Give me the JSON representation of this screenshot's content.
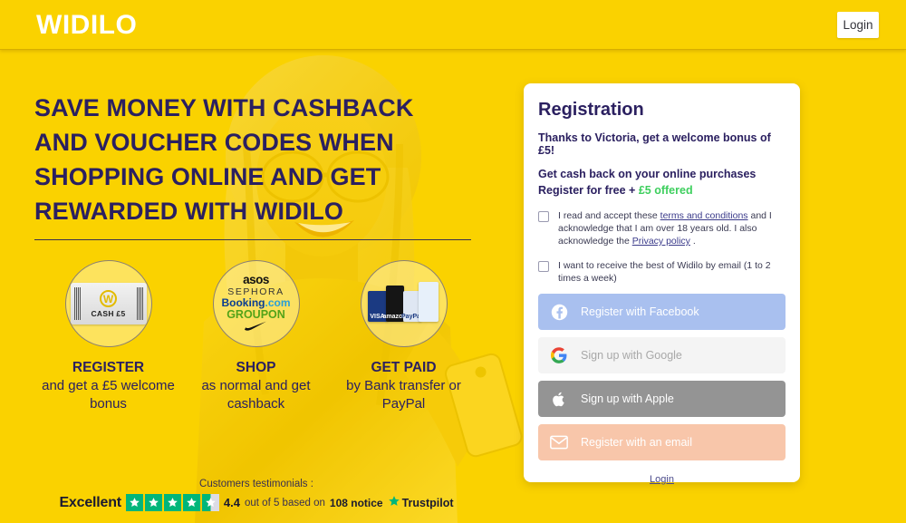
{
  "header": {
    "logo": "WIDILO",
    "login_label": "Login"
  },
  "hero": {
    "headline": "SAVE MONEY WITH CASHBACK AND VOUCHER CODES WHEN SHOPPING ONLINE AND GET REWARDED WITH WIDILO"
  },
  "steps": [
    {
      "title": "REGISTER",
      "desc": "and get a £5 welcome bonus",
      "graphic": "voucher-cash-5",
      "voucher_logo": "W",
      "voucher_text": "CASH £5"
    },
    {
      "title": "SHOP",
      "desc": "as normal and get cashback",
      "graphic": "brand-logos",
      "brands": [
        "asos",
        "SEPHORA",
        "Booking.com",
        "GROUPON",
        "Nike"
      ]
    },
    {
      "title": "GET PAID",
      "desc": "by Bank transfer or PayPal",
      "graphic": "payment-cards",
      "cards": [
        "VISA",
        "amazon",
        "PayPal",
        "card"
      ]
    }
  ],
  "testimonials": {
    "label": "Customers testimonials :",
    "rating_word": "Excellent",
    "score": "4.4",
    "out_of_text": "out of 5 based on",
    "count": "108 notice",
    "brand": "Trustpilot",
    "stars_full": 4,
    "stars_half": 1,
    "star_color": "#00b67a"
  },
  "registration": {
    "title": "Registration",
    "referral": "Thanks to Victoria, get a welcome bonus of £5!",
    "benefit": "Get cash back on your online purchases",
    "offer_prefix": "Register for free",
    "offer_plus": "+",
    "offer_value": "£5 offered",
    "offer_color": "#3ecf5e",
    "terms": {
      "part1": "I read and accept these ",
      "link1": "terms and conditions",
      "part2": " and I acknowledge that I am over 18 years old. I also acknowledge the ",
      "link2": "Privacy policy",
      "part3": " ."
    },
    "newsletter": "I want to receive the best of Widilo by email (1 to 2 times a week)",
    "buttons": [
      {
        "label": "Register with Facebook",
        "icon": "facebook-icon",
        "color": "#a9c0ef"
      },
      {
        "label": "Sign up with Google",
        "icon": "google-icon",
        "color": "#f4f4f4"
      },
      {
        "label": "Sign up with Apple",
        "icon": "apple-icon",
        "color": "#949494"
      },
      {
        "label": "Register with an email",
        "icon": "envelope-icon",
        "color": "#f8c6aa"
      }
    ],
    "login_link": "Login"
  },
  "theme": {
    "background": "#fad200",
    "text_dark": "#2b2060"
  }
}
